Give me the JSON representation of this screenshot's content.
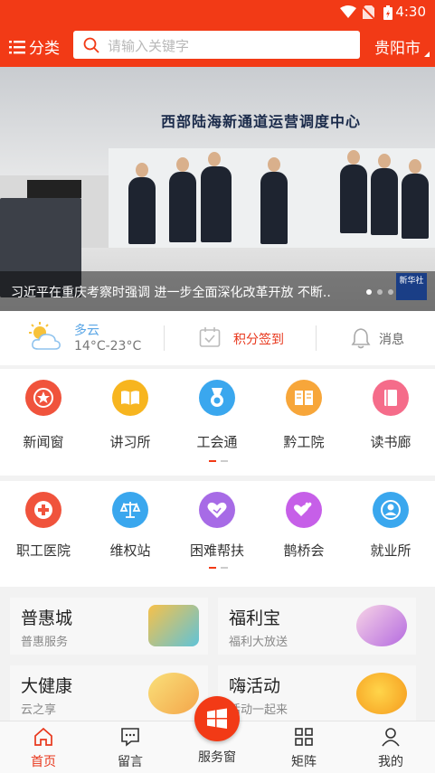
{
  "status_bar": {
    "time": "4:30"
  },
  "header": {
    "category_label": "分类",
    "search_placeholder": "请输入关键字",
    "city": "贵阳市"
  },
  "banner": {
    "sign_text": "西部陆海新通道运营调度中心",
    "caption": "习近平在重庆考察时强调 进一步全面深化改革开放 不断..",
    "source_badge": "新华社",
    "active_dot": 0,
    "dot_count": 3
  },
  "info_row": {
    "weather_condition": "多云",
    "weather_temp": "14°C-23°C",
    "signin_label": "积分签到",
    "message_label": "消息"
  },
  "grid_1": {
    "items": [
      {
        "label": "新闻窗",
        "icon": "star-icon",
        "color": "#f0533c"
      },
      {
        "label": "讲习所",
        "icon": "book-open-icon",
        "color": "#f7b51f"
      },
      {
        "label": "工会通",
        "icon": "medal-icon",
        "color": "#3aa7ee"
      },
      {
        "label": "黔工院",
        "icon": "reader-icon",
        "color": "#f7a63a"
      },
      {
        "label": "读书廊",
        "icon": "book-icon",
        "color": "#f56c8a"
      }
    ]
  },
  "grid_2": {
    "items": [
      {
        "label": "职工医院",
        "icon": "medical-cross-icon",
        "color": "#f0533c"
      },
      {
        "label": "维权站",
        "icon": "scales-icon",
        "color": "#3aa7ee"
      },
      {
        "label": "困难帮扶",
        "icon": "heart-hand-icon",
        "color": "#a76be6"
      },
      {
        "label": "鹊桥会",
        "icon": "hearts-icon",
        "color": "#c65fe8"
      },
      {
        "label": "就业所",
        "icon": "person-icon",
        "color": "#3aa7ee"
      }
    ]
  },
  "services": [
    {
      "title": "普惠城",
      "subtitle": "普惠服务"
    },
    {
      "title": "福利宝",
      "subtitle": "福利大放送"
    },
    {
      "title": "大健康",
      "subtitle": "云之享"
    },
    {
      "title": "嗨活动",
      "subtitle": "活动一起来"
    }
  ],
  "bottom_nav": {
    "items": [
      {
        "label": "首页",
        "icon": "home-icon",
        "active": true
      },
      {
        "label": "留言",
        "icon": "chat-icon",
        "active": false
      },
      {
        "label": "服务窗",
        "icon": "windows-icon",
        "active": false
      },
      {
        "label": "矩阵",
        "icon": "grid-icon",
        "active": false
      },
      {
        "label": "我的",
        "icon": "user-icon",
        "active": false
      }
    ]
  },
  "colors": {
    "brand": "#f23a16",
    "accent_text": "#e8371c",
    "weather": "#5aa6e6"
  }
}
